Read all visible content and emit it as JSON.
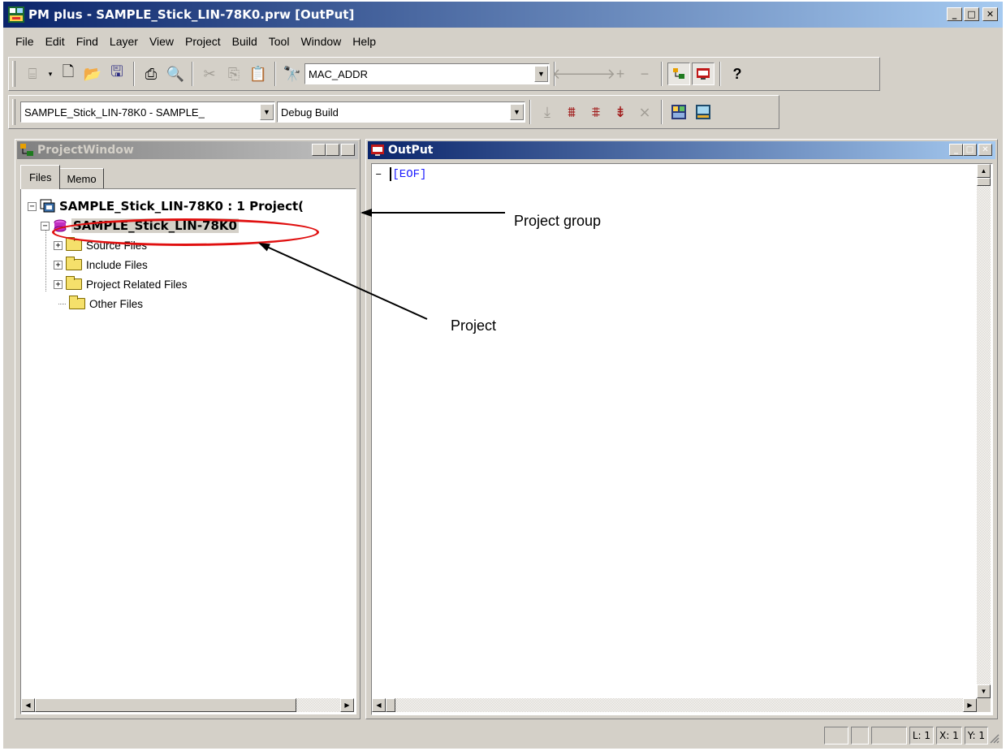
{
  "window": {
    "title": "PM plus - SAMPLE_Stick_LIN-78K0.prw [OutPut]",
    "min_label": "_",
    "max_label": "□",
    "close_label": "✕"
  },
  "menubar": [
    "File",
    "Edit",
    "Find",
    "Layer",
    "View",
    "Project",
    "Build",
    "Tool",
    "Window",
    "Help"
  ],
  "toolbar1": {
    "search_combo_value": "MAC_ADDR",
    "help_glyph": "?"
  },
  "toolbar2": {
    "project_combo_value": "SAMPLE_Stick_LIN-78K0 - SAMPLE_",
    "build_combo_value": "Debug Build"
  },
  "project_window": {
    "title": "ProjectWindow",
    "tabs": [
      "Files",
      "Memo"
    ],
    "tree": {
      "group": "SAMPLE_Stick_LIN-78K0 : 1 Project(",
      "project": "SAMPLE_Stick_LIN-78K0",
      "folders": [
        "Source Files",
        "Include Files",
        "Project Related Files",
        "Other Files"
      ]
    }
  },
  "output_window": {
    "title": "OutPut",
    "line_prefix": "–",
    "content": "[EOF]"
  },
  "statusbar": {
    "line": "L: 1",
    "x": "X: 1",
    "y": "Y: 1"
  },
  "annotations": {
    "project_group": "Project group",
    "project": "Project"
  },
  "colors": {
    "title_active": "#0a246a",
    "title_inactive": "#808080",
    "annotation_red": "#e01010",
    "eof_blue": "#1a1aff"
  }
}
